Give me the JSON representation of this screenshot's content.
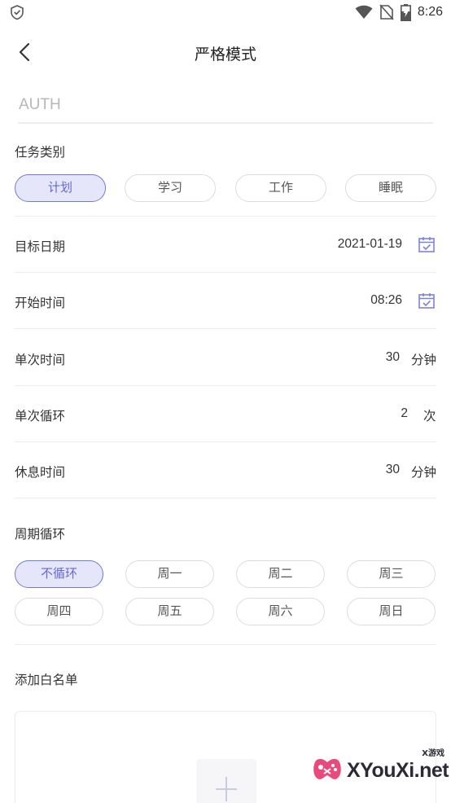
{
  "status_bar": {
    "time": "8:26"
  },
  "header": {
    "title": "严格模式",
    "back_icon": "chevron-left-icon"
  },
  "auth": {
    "placeholder": "AUTH",
    "value": ""
  },
  "task_category": {
    "label": "任务类别",
    "options": [
      "计划",
      "学习",
      "工作",
      "睡眠"
    ],
    "selected": "计划"
  },
  "rows": {
    "target_date": {
      "label": "目标日期",
      "value": "2021-01-19",
      "icon": "calendar-icon"
    },
    "start_time": {
      "label": "开始时间",
      "value": "08:26",
      "icon": "calendar-icon"
    },
    "single_duration": {
      "label": "单次时间",
      "value": "30",
      "unit": "分钟"
    },
    "single_cycle": {
      "label": "单次循环",
      "value": "2",
      "unit": "次"
    },
    "rest_time": {
      "label": "休息时间",
      "value": "30",
      "unit": "分钟"
    }
  },
  "period_cycle": {
    "label": "周期循环",
    "options": [
      "不循环",
      "周一",
      "周二",
      "周三",
      "周四",
      "周五",
      "周六",
      "周日"
    ],
    "selected": "不循环"
  },
  "whitelist": {
    "label": "添加白名单",
    "add_icon": "plus-icon"
  },
  "watermark": {
    "small": "X游戏",
    "text": "XYouXi.net"
  },
  "colors": {
    "accent": "#6469cf",
    "accent_bg": "#e6e6fb",
    "divider": "#ececec"
  }
}
